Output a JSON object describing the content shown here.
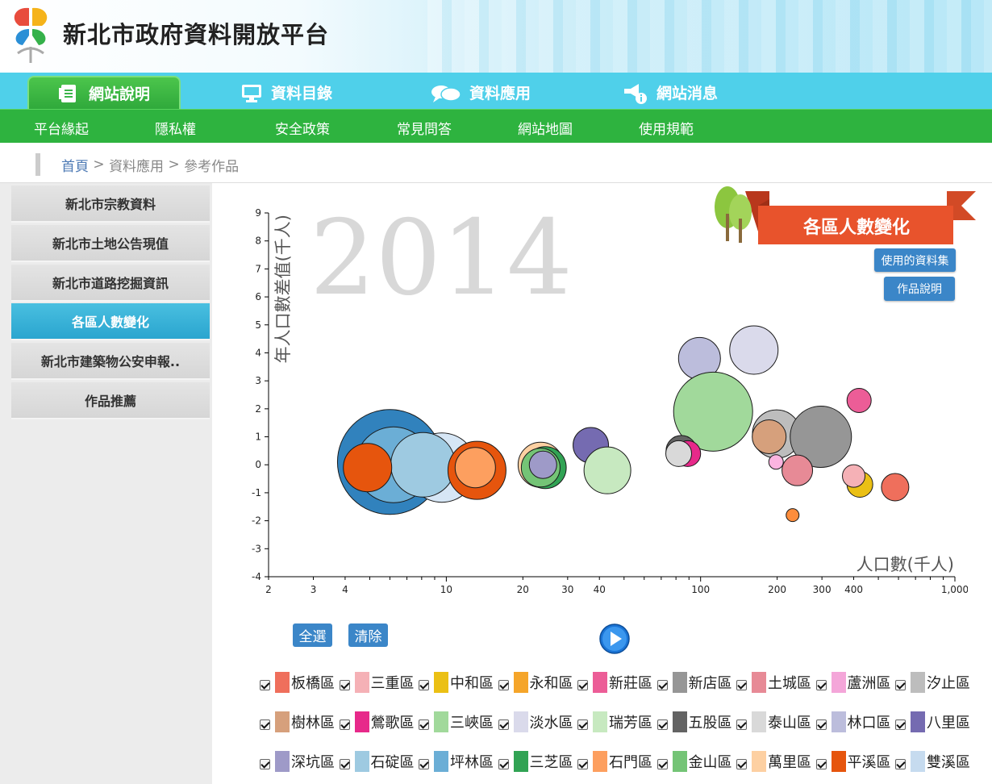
{
  "site": {
    "title": "新北市政府資料開放平台"
  },
  "main_nav": [
    {
      "label": "網站說明",
      "icon": "document-icon",
      "active": true
    },
    {
      "label": "資料目錄",
      "icon": "monitor-icon",
      "active": false
    },
    {
      "label": "資料應用",
      "icon": "chat-bubbles-icon",
      "active": false
    },
    {
      "label": "網站消息",
      "icon": "megaphone-info-icon",
      "active": false
    }
  ],
  "sub_nav": [
    "平台緣起",
    "隱私權",
    "安全政策",
    "常見問答",
    "網站地圖",
    "使用規範"
  ],
  "breadcrumb": {
    "home": "首頁",
    "sep1": " > ",
    "section": "資料應用",
    "sep2": " > ",
    "page": "參考作品"
  },
  "sidebar": [
    {
      "label": "新北市宗教資料",
      "active": false
    },
    {
      "label": "新北市土地公告現值",
      "active": false
    },
    {
      "label": "新北市道路挖掘資訊",
      "active": false
    },
    {
      "label": "各區人數變化",
      "active": true
    },
    {
      "label": "新北市建築物公安申報..",
      "active": false
    },
    {
      "label": "作品推薦",
      "active": false
    }
  ],
  "banner": {
    "title": "各區人數變化",
    "dataset_button": "使用的資料集",
    "desc_button": "作品說明"
  },
  "controls": {
    "select_all": "全選",
    "clear": "清除",
    "play_icon": "play-icon"
  },
  "colors": {
    "nav_blue": "#4fd0ea",
    "nav_green": "#2eb33f",
    "active_side": "#2aa5cf",
    "banner_red": "#e8532c",
    "button_blue": "#3b86c8"
  },
  "chart_data": {
    "type": "scatter",
    "year_label": "2014",
    "xlabel": "人口數(千人)",
    "ylabel": "年人口數差值(千人)",
    "xscale": "log",
    "xlim": [
      2,
      1000
    ],
    "ylim": [
      -4,
      9
    ],
    "x_tick_labels": [
      "2",
      "3",
      "4",
      "10",
      "20",
      "30",
      "40",
      "100",
      "200",
      "300",
      "400",
      "1,000"
    ],
    "y_ticks": [
      -4,
      -3,
      -2,
      -1,
      0,
      1,
      2,
      3,
      4,
      5,
      6,
      7,
      8,
      9
    ],
    "points": [
      {
        "x": 6.0,
        "y": 0.1,
        "r": 65,
        "color": "#3182bd"
      },
      {
        "x": 6.2,
        "y": 0.0,
        "r": 47,
        "color": "#6baed6"
      },
      {
        "x": 9.6,
        "y": -0.1,
        "r": 43,
        "color": "#d6e6f5"
      },
      {
        "x": 8.1,
        "y": 0.0,
        "r": 40,
        "color": "#9ecae1"
      },
      {
        "x": 4.9,
        "y": -0.1,
        "r": 30,
        "color": "#e6550d"
      },
      {
        "x": 13.2,
        "y": -0.2,
        "r": 36,
        "color": "#e6550d"
      },
      {
        "x": 13.0,
        "y": -0.1,
        "r": 25,
        "color": "#fd9f5f"
      },
      {
        "x": 23.5,
        "y": 0.0,
        "r": 28,
        "color": "#fdd0a2"
      },
      {
        "x": 24.5,
        "y": -0.1,
        "r": 26,
        "color": "#31a354"
      },
      {
        "x": 23.5,
        "y": -0.1,
        "r": 24,
        "color": "#74c476"
      },
      {
        "x": 24.0,
        "y": 0.0,
        "r": 17,
        "color": "#9e9ac8"
      },
      {
        "x": 37.0,
        "y": 0.7,
        "r": 22,
        "color": "#756bb1"
      },
      {
        "x": 43.0,
        "y": -0.2,
        "r": 29,
        "color": "#c7e9c0"
      },
      {
        "x": 99.0,
        "y": 3.8,
        "r": 26,
        "color": "#bcbddc"
      },
      {
        "x": 162.0,
        "y": 4.1,
        "r": 30,
        "color": "#dadaeb"
      },
      {
        "x": 112.0,
        "y": 1.9,
        "r": 49,
        "color": "#a1d99b"
      },
      {
        "x": 84.0,
        "y": 0.5,
        "r": 19,
        "color": "#636363"
      },
      {
        "x": 89.0,
        "y": 0.4,
        "r": 16,
        "color": "#e7298a"
      },
      {
        "x": 82.0,
        "y": 0.4,
        "r": 16,
        "color": "#d9d9d9"
      },
      {
        "x": 199.0,
        "y": 1.1,
        "r": 30,
        "color": "#bdbdbd"
      },
      {
        "x": 186.0,
        "y": 1.0,
        "r": 21,
        "color": "#d6a07c"
      },
      {
        "x": 297.0,
        "y": 1.0,
        "r": 38,
        "color": "#969696"
      },
      {
        "x": 420.0,
        "y": 2.3,
        "r": 15,
        "color": "#ec5d97"
      },
      {
        "x": 198.0,
        "y": 0.1,
        "r": 9,
        "color": "#fbb4e0"
      },
      {
        "x": 240.0,
        "y": -0.2,
        "r": 19,
        "color": "#e78a96"
      },
      {
        "x": 230.0,
        "y": -1.8,
        "r": 8,
        "color": "#fd8d3c"
      },
      {
        "x": 423.0,
        "y": -0.7,
        "r": 16,
        "color": "#ebc014"
      },
      {
        "x": 400.0,
        "y": -0.4,
        "r": 14,
        "color": "#f5b1b6"
      },
      {
        "x": 582.0,
        "y": -0.8,
        "r": 17,
        "color": "#ef6f5c"
      }
    ]
  },
  "legend": [
    {
      "label": "板橋區",
      "color": "#ef6f5c"
    },
    {
      "label": "三重區",
      "color": "#f5b1b6"
    },
    {
      "label": "中和區",
      "color": "#ebc014"
    },
    {
      "label": "永和區",
      "color": "#f5a52a"
    },
    {
      "label": "新莊區",
      "color": "#ec5d97"
    },
    {
      "label": "新店區",
      "color": "#969696"
    },
    {
      "label": "土城區",
      "color": "#e78a96"
    },
    {
      "label": "蘆洲區",
      "color": "#f4a6d9"
    },
    {
      "label": "汐止區",
      "color": "#bdbdbd"
    },
    {
      "label": "樹林區",
      "color": "#d6a07c"
    },
    {
      "label": "鶯歌區",
      "color": "#e7298a"
    },
    {
      "label": "三峽區",
      "color": "#a1d99b"
    },
    {
      "label": "淡水區",
      "color": "#dadaeb"
    },
    {
      "label": "瑞芳區",
      "color": "#c7e9c0"
    },
    {
      "label": "五股區",
      "color": "#636363"
    },
    {
      "label": "泰山區",
      "color": "#d9d9d9"
    },
    {
      "label": "林口區",
      "color": "#bcbddc"
    },
    {
      "label": "八里區",
      "color": "#756bb1"
    },
    {
      "label": "深坑區",
      "color": "#9e9ac8"
    },
    {
      "label": "石碇區",
      "color": "#9ecae1"
    },
    {
      "label": "坪林區",
      "color": "#6baed6"
    },
    {
      "label": "三芝區",
      "color": "#31a354"
    },
    {
      "label": "石門區",
      "color": "#fd9f5f"
    },
    {
      "label": "金山區",
      "color": "#74c476"
    },
    {
      "label": "萬里區",
      "color": "#fdd0a2"
    },
    {
      "label": "平溪區",
      "color": "#e6550d"
    },
    {
      "label": "雙溪區",
      "color": "#c6dbef"
    }
  ]
}
